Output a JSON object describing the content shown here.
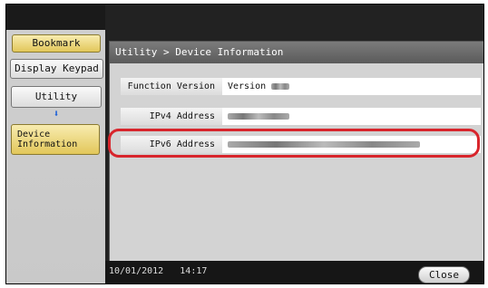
{
  "sidebar": {
    "bookmark_label": "Bookmark",
    "display_keypad_label": "Display Keypad",
    "utility_label": "Utility",
    "arrow_glyph": "⬇",
    "device_info_line1": "Device",
    "device_info_line2": "Information"
  },
  "dialog": {
    "breadcrumb": "Utility > Device Information",
    "rows": [
      {
        "label": "Function Version",
        "value": "Version"
      },
      {
        "label": "IPv4 Address",
        "value": ""
      },
      {
        "label": "IPv6 Address",
        "value": ""
      }
    ]
  },
  "status": {
    "date": "10/01/2012",
    "time": "14:17"
  },
  "footer": {
    "close_label": "Close"
  },
  "colors": {
    "highlight": "#d8252c",
    "accent_yellow": "#e2c75a",
    "arrow_blue": "#1a5fd8"
  }
}
